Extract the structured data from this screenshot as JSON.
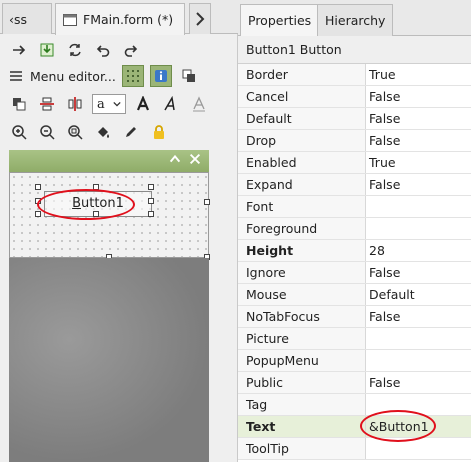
{
  "editor": {
    "tabs": [
      {
        "label": "‹ss",
        "active": false
      },
      {
        "label": "FMain.form (*)",
        "active": true
      }
    ],
    "menu_editor_label": "Menu editor...",
    "font_selector": {
      "value": "a"
    }
  },
  "form_designer": {
    "button": {
      "label": "Button1",
      "mnemonic": "B"
    }
  },
  "properties_panel": {
    "tabs": [
      {
        "label": "Properties",
        "active": true
      },
      {
        "label": "Hierarchy",
        "active": false
      }
    ],
    "object_title": "Button1 Button",
    "rows": [
      {
        "name": "Border",
        "value": "True"
      },
      {
        "name": "Cancel",
        "value": "False"
      },
      {
        "name": "Default",
        "value": "False"
      },
      {
        "name": "Drop",
        "value": "False"
      },
      {
        "name": "Enabled",
        "value": "True"
      },
      {
        "name": "Expand",
        "value": "False"
      },
      {
        "name": "Font",
        "value": ""
      },
      {
        "name": "Foreground",
        "value": ""
      },
      {
        "name": "Height",
        "value": "28",
        "bold": true
      },
      {
        "name": "Ignore",
        "value": "False"
      },
      {
        "name": "Mouse",
        "value": "Default"
      },
      {
        "name": "NoTabFocus",
        "value": "False"
      },
      {
        "name": "Picture",
        "value": ""
      },
      {
        "name": "PopupMenu",
        "value": ""
      },
      {
        "name": "Public",
        "value": "False"
      },
      {
        "name": "Tag",
        "value": ""
      },
      {
        "name": "Text",
        "value": "&Button1",
        "bold": true,
        "selected": true
      },
      {
        "name": "ToolTip",
        "value": ""
      }
    ]
  },
  "colors": {
    "accent_green": "#9bb577",
    "highlight_red": "#e0101c",
    "selected_row": "#e7f0d9"
  }
}
